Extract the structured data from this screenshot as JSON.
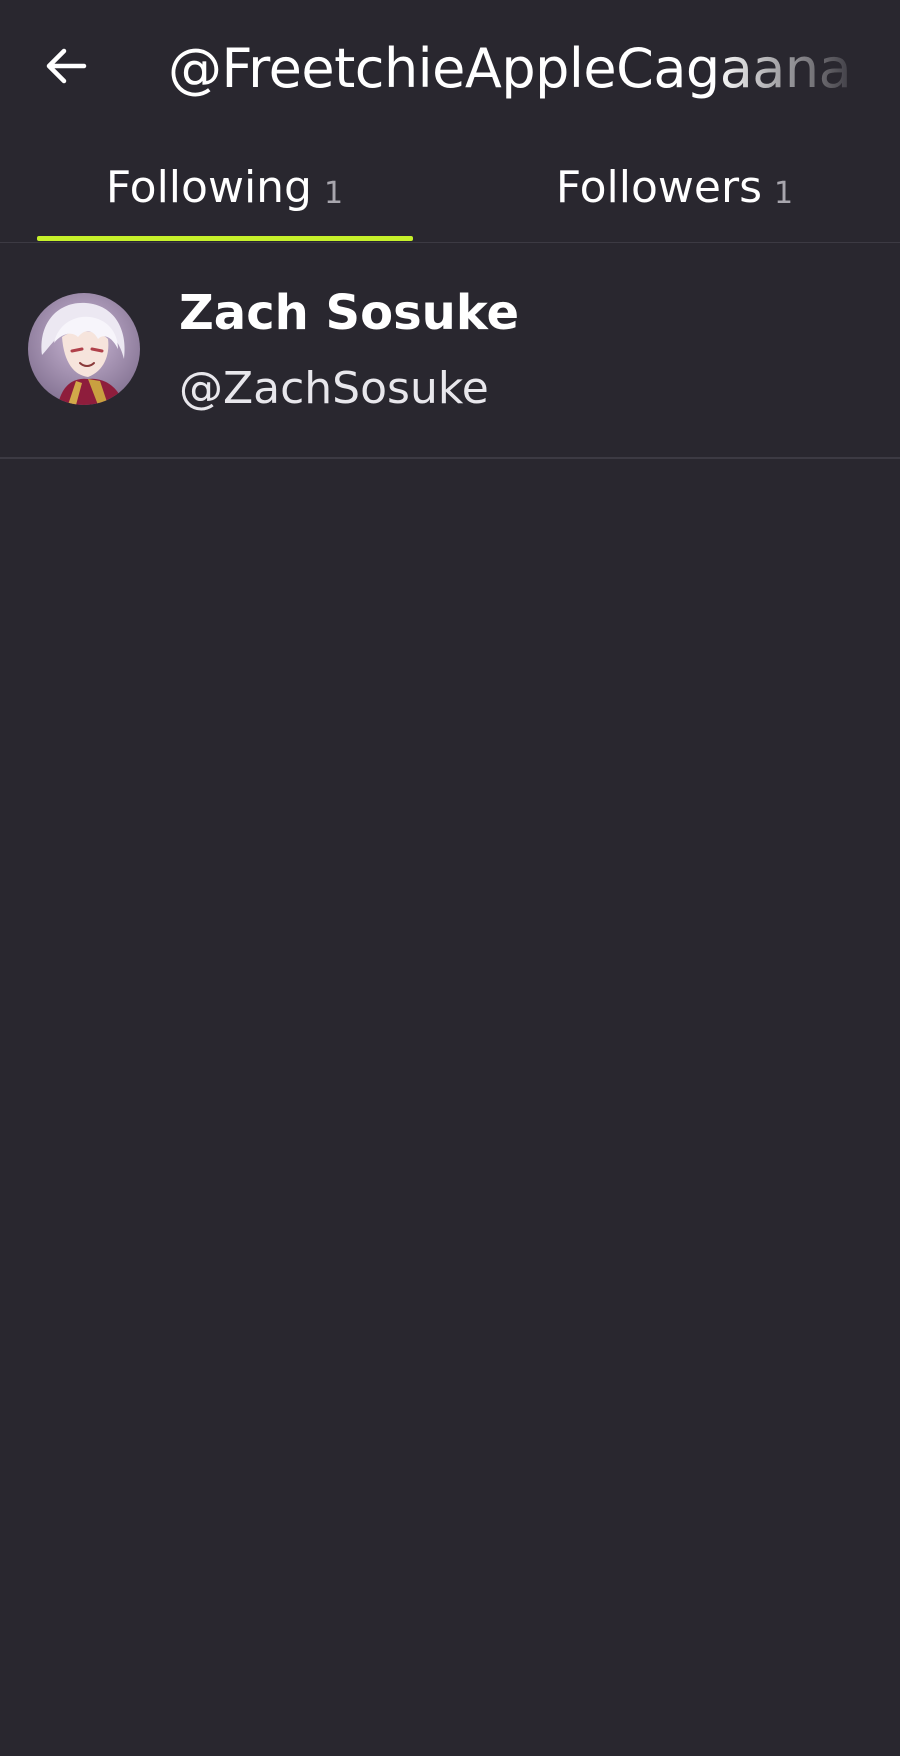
{
  "header": {
    "title": "@FreetchieAppleCagaana",
    "back_icon": "arrow-left-icon"
  },
  "tabs": [
    {
      "label": "Following",
      "count": "1",
      "active": true
    },
    {
      "label": "Followers",
      "count": "1",
      "active": false
    }
  ],
  "colors": {
    "background": "#29272f",
    "accent": "#c6f12a",
    "divider": "#3c3a43",
    "count_text": "#a8a6ae"
  },
  "list": [
    {
      "name": "Zach Sosuke",
      "handle": "@ZachSosuke",
      "avatar_icon": "anime-avatar-image"
    }
  ]
}
